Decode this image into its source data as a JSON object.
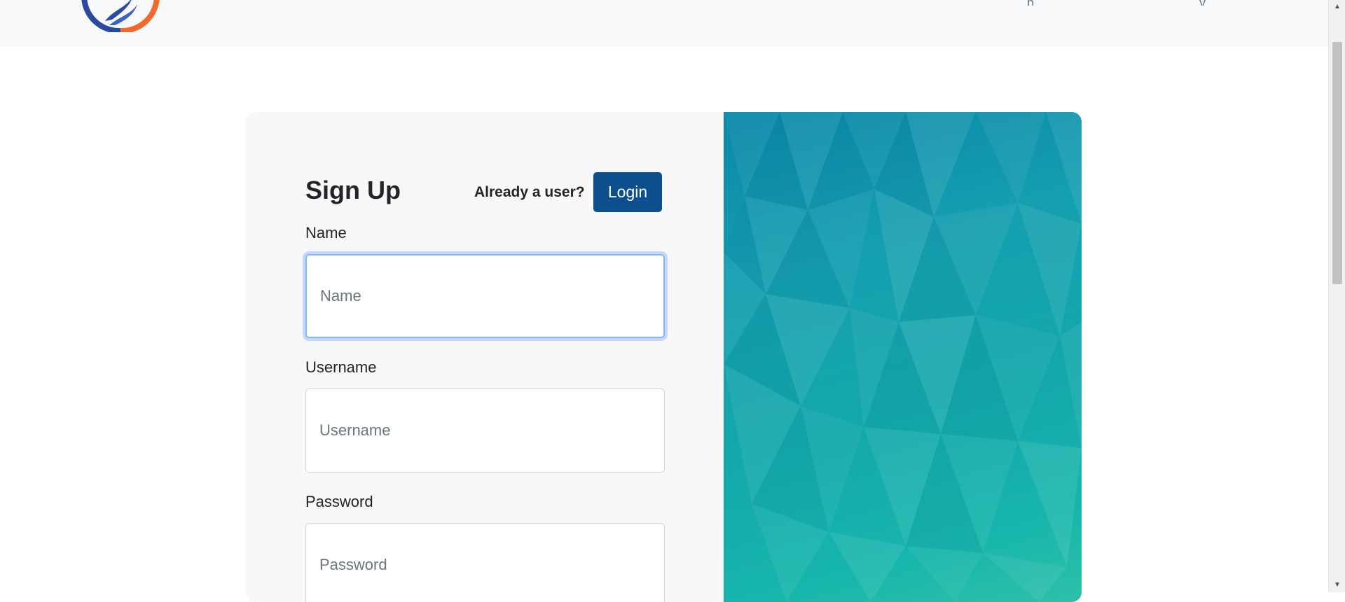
{
  "header": {
    "nav_fragments": [
      "p",
      "y"
    ]
  },
  "form": {
    "title": "Sign Up",
    "already_user_text": "Already a user?",
    "login_button": "Login",
    "fields": [
      {
        "label": "Name",
        "placeholder": "Name",
        "value": ""
      },
      {
        "label": "Username",
        "placeholder": "Username",
        "value": ""
      },
      {
        "label": "Password",
        "placeholder": "Password",
        "value": ""
      }
    ]
  },
  "colors": {
    "primary_button": "#0c4f8c",
    "navbar_bg": "#f8f9fa",
    "focus_ring": "#86b7fe",
    "art_gradient_start": "#0a87a8",
    "art_gradient_end": "#2ec0a8"
  },
  "icons": {
    "logo": "circular-brand-logo-icon",
    "scroll_up": "triangle-up-icon",
    "scroll_down": "triangle-down-icon"
  }
}
